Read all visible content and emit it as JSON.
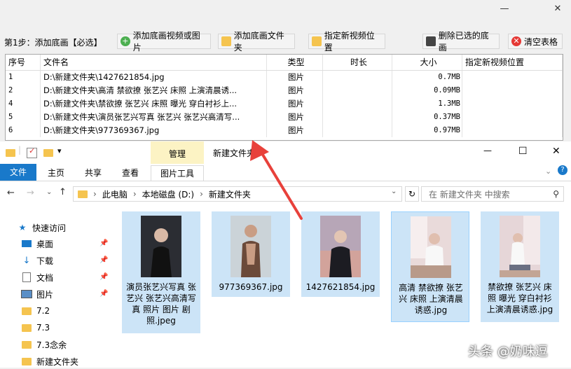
{
  "window": {
    "minimize": "—",
    "close": "✕"
  },
  "toolbar": {
    "step_label": "第1步：添加底画【必选】",
    "add_video_label": "添加底画视频或图片",
    "add_folder_label": "添加底画文件夹",
    "set_position_label": "指定新视频位置",
    "delete_selected_label": "删除已选的底画",
    "clear_table_label": "清空表格"
  },
  "table": {
    "headers": [
      "序号",
      "文件名",
      "类型",
      "时长",
      "大小",
      "指定新视频位置"
    ],
    "rows": [
      {
        "index": "1",
        "name": "D:\\新建文件夹\\1427621854.jpg",
        "type": "图片",
        "duration": "",
        "size": "0.7MB",
        "target": ""
      },
      {
        "index": "2",
        "name": "D:\\新建文件夹\\高清 禁欲撩 张艺兴 床照 上演清晨诱...",
        "type": "图片",
        "duration": "",
        "size": "0.09MB",
        "target": ""
      },
      {
        "index": "4",
        "name": "D:\\新建文件夹\\禁欲撩 张艺兴 床照 曝光 穿白衬衫上...",
        "type": "图片",
        "duration": "",
        "size": "1.3MB",
        "target": ""
      },
      {
        "index": "5",
        "name": "D:\\新建文件夹\\演员张艺兴写真 张艺兴 张艺兴高清写...",
        "type": "图片",
        "duration": "",
        "size": "0.37MB",
        "target": ""
      },
      {
        "index": "6",
        "name": "D:\\新建文件夹\\977369367.jpg",
        "type": "图片",
        "duration": "",
        "size": "0.97MB",
        "target": ""
      }
    ]
  },
  "explorer": {
    "quick_access_dropdown": "▾",
    "manage_tab": "管理",
    "title": "新建文件夹",
    "minimize": "—",
    "maximize": "☐",
    "close": "✕",
    "ribbon_tabs": [
      "文件",
      "主页",
      "共享",
      "查看",
      "图片工具"
    ],
    "help": "?",
    "breadcrumb": [
      "此电脑",
      "本地磁盘 (D:)",
      "新建文件夹"
    ],
    "search_placeholder": "在 新建文件夹 中搜索",
    "nav": [
      {
        "label": "快速访问",
        "icon": "star-icon",
        "pinned": false
      },
      {
        "label": "桌面",
        "icon": "desktop-icon",
        "pinned": true
      },
      {
        "label": "下载",
        "icon": "download-icon",
        "pinned": true
      },
      {
        "label": "文档",
        "icon": "document-icon",
        "pinned": true
      },
      {
        "label": "图片",
        "icon": "picture-icon",
        "pinned": true
      },
      {
        "label": "7.2",
        "icon": "folder-icon",
        "pinned": false
      },
      {
        "label": "7.3",
        "icon": "folder-icon",
        "pinned": false
      },
      {
        "label": "7.3念余",
        "icon": "folder-icon",
        "pinned": false
      },
      {
        "label": "新建文件夹",
        "icon": "folder-icon",
        "pinned": false
      }
    ],
    "files": [
      {
        "label": "演员张艺兴写真 张艺兴 张艺兴高清写真 照片 图片 剧照.jpeg",
        "selected": true
      },
      {
        "label": "977369367.jpg",
        "selected": true
      },
      {
        "label": "1427621854.jpg",
        "selected": true
      },
      {
        "label": "高清 禁欲撩 张艺兴 床照 上演清晨诱惑.jpg",
        "selected": true
      },
      {
        "label": "禁欲撩 张艺兴 床照 曝光 穿白衬衫上演清晨诱惑.jpg",
        "selected": true
      }
    ]
  },
  "watermark": "头条 @奶味逗",
  "colors": {
    "accent": "#1979ca",
    "selection": "#cce4f7",
    "manage_tab": "#fcf3c4",
    "arrow": "#e8413b"
  }
}
